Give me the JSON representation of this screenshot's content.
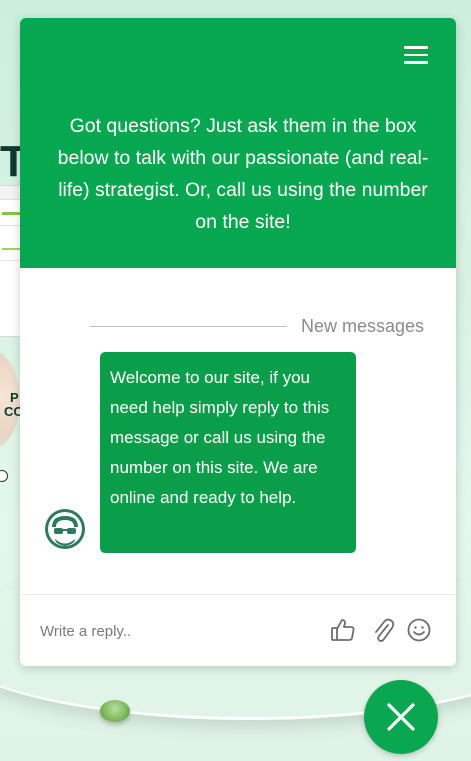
{
  "background": {
    "letter": "T",
    "side_text_1": "P",
    "side_text_2": "CO"
  },
  "widget": {
    "header": {
      "menu_icon": "hamburger-menu-icon",
      "intro_text": "Got questions? Just ask them in the box below to talk with our passionate (and real-life) strategist. Or, call us using the number on the site!"
    },
    "conversation": {
      "divider_label": "New messages",
      "message_text": "Welcome to our site, if you need help simply reply to this message or call us using the number on this site. We are online and ready to help.",
      "avatar_icon": "agent-avatar-icon"
    },
    "footer": {
      "reply_placeholder": "Write a reply..",
      "icons": [
        "thumbs-up-icon",
        "paperclip-icon",
        "smiley-icon"
      ]
    }
  },
  "close_button_icon": "close-icon",
  "colors": {
    "brand_green": "#07a650",
    "bubble_green": "#0a9e4b"
  }
}
